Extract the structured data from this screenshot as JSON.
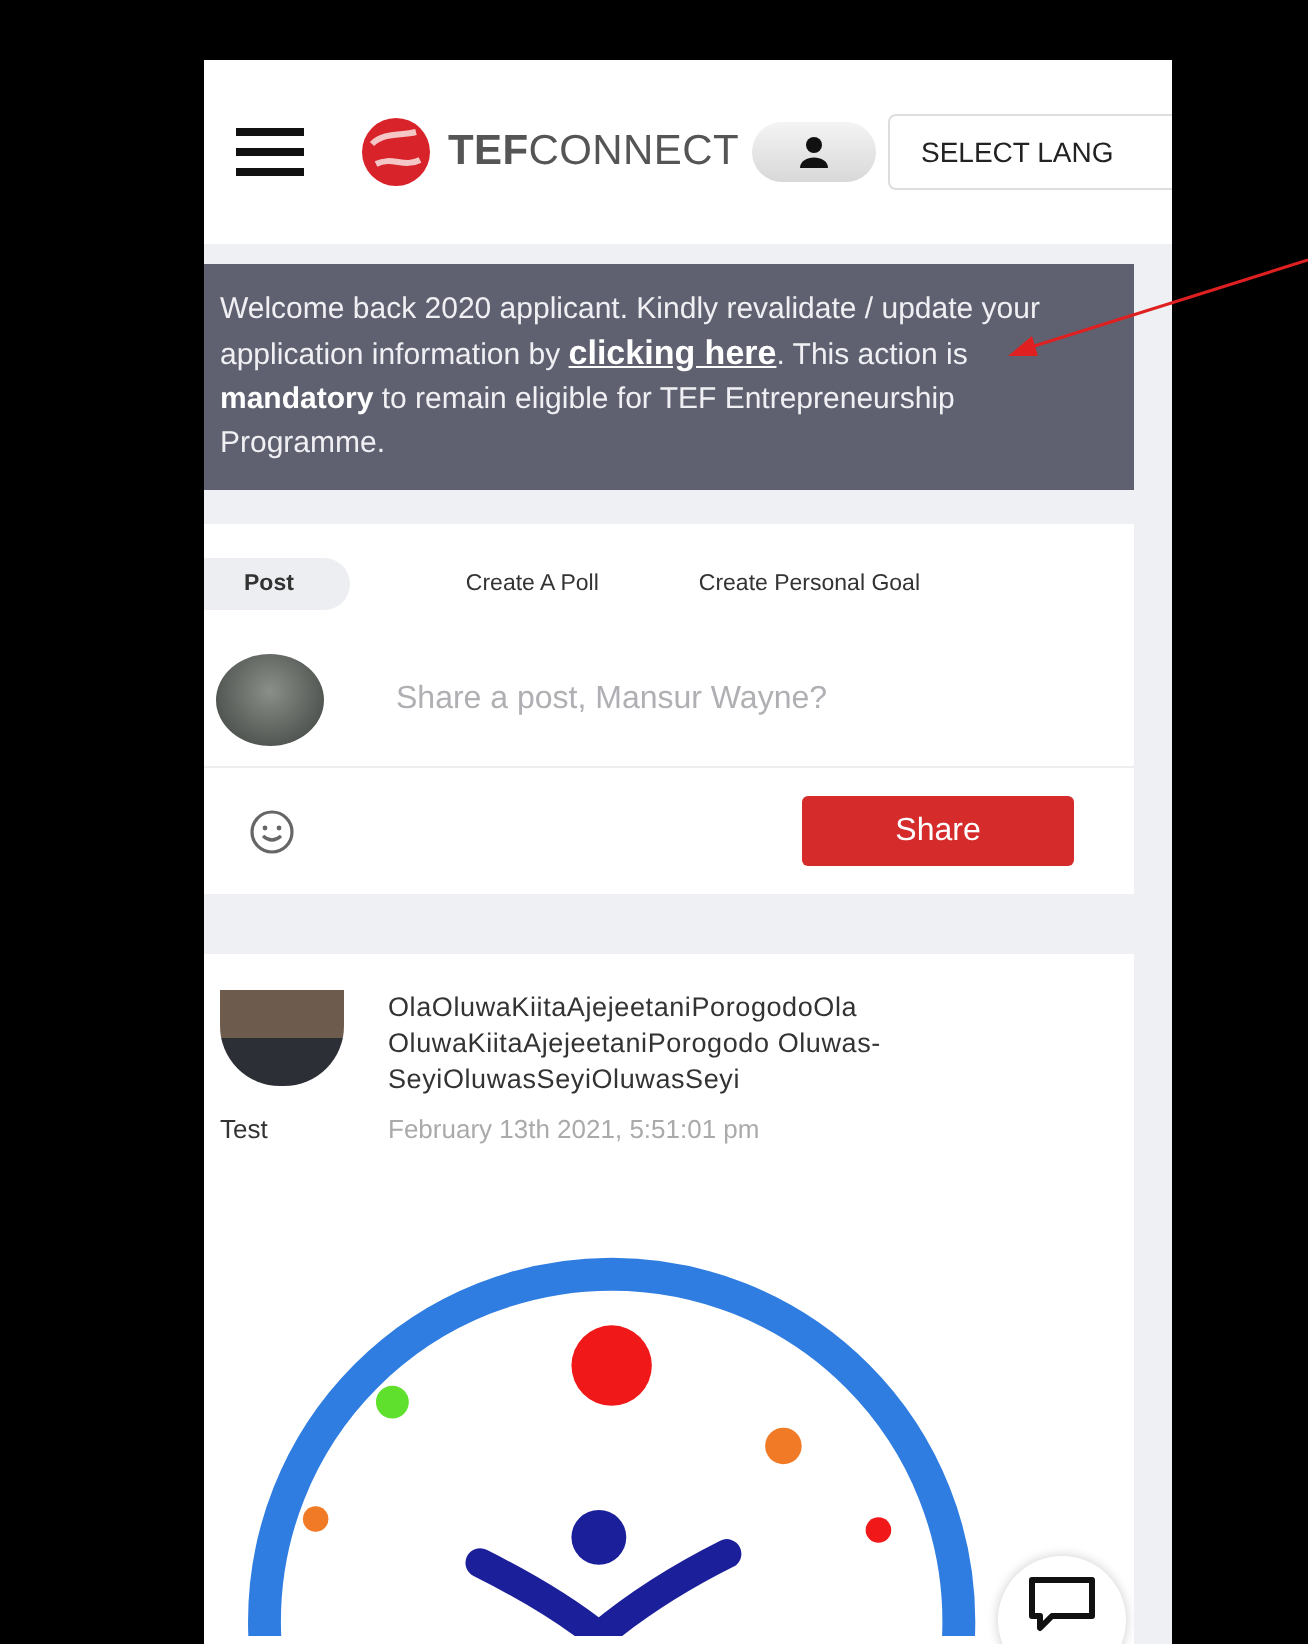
{
  "header": {
    "brand_bold": "TEF",
    "brand_light": "CONNECT",
    "language_select": "SELECT LANG"
  },
  "notice": {
    "before": "Welcome back 2020 applicant. Kindly revalidate / update your application information by",
    "link": "clicking here",
    "after": ". This action is **mandatory** to remain eligible for TEF Entrepreneurship Programme."
  },
  "composer": {
    "tabs": [
      {
        "label": "Post",
        "selected": true
      },
      {
        "label": "Create A Poll",
        "selected": false
      },
      {
        "label": "Create Personal Goal",
        "selected": false
      }
    ],
    "placeholder": "Share a post, Mansur Wayne?",
    "share_button": "Share"
  },
  "post": {
    "author_label": "Test",
    "title": "OlaOluwaKiitaAjejeetaniPorogodoOla\nOluwaKiitaAjejeetaniPorogodo Oluwas-\nSeyiOluwasSeyiOluwasSeyi",
    "date": "February 13th 2021, 5:51:01 pm"
  }
}
